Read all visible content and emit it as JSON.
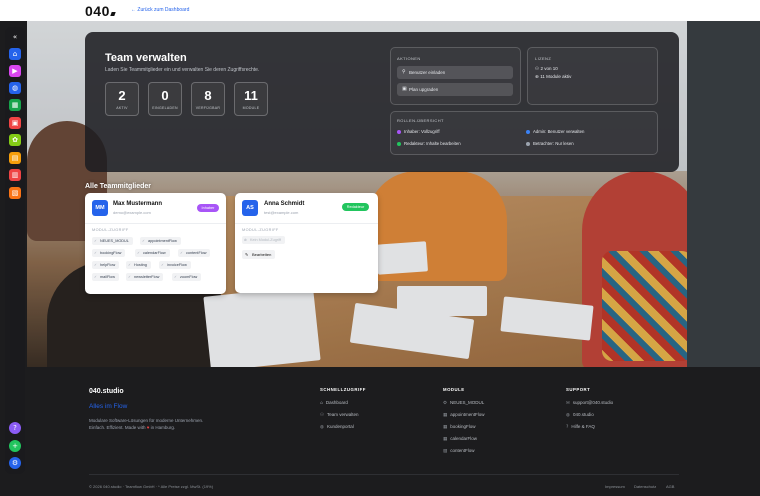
{
  "header": {
    "logo": "040",
    "back_link": "← Zurück zum Dashboard"
  },
  "sidebar": {
    "items": [
      {
        "icon": "collapse-icon",
        "color": "#2b2b30",
        "glyph": "«"
      },
      {
        "icon": "home-icon",
        "color": "#2563eb",
        "glyph": "⌂"
      },
      {
        "icon": "video-icon",
        "color": "#d946ef",
        "glyph": "▶"
      },
      {
        "icon": "globe-icon",
        "color": "#2563eb",
        "glyph": "◍"
      },
      {
        "icon": "calendar-icon",
        "color": "#16a34a",
        "glyph": "▦"
      },
      {
        "icon": "briefcase-icon",
        "color": "#ef4444",
        "glyph": "▣"
      },
      {
        "icon": "leaf-icon",
        "color": "#84cc16",
        "glyph": "✿"
      },
      {
        "icon": "calendar-check-icon",
        "color": "#f59e0b",
        "glyph": "▤"
      },
      {
        "icon": "invoice-icon",
        "color": "#ef4444",
        "glyph": "▥"
      },
      {
        "icon": "document-icon",
        "color": "#f97316",
        "glyph": "▧"
      },
      {
        "icon": "help-icon",
        "color": "#8b5cf6",
        "glyph": "?"
      },
      {
        "icon": "add-icon",
        "color": "#22c55e",
        "glyph": "+"
      },
      {
        "icon": "settings-icon",
        "color": "#2563eb",
        "glyph": "⚙"
      }
    ]
  },
  "team": {
    "title": "Team verwalten",
    "subtitle": "Laden Sie Teammitglieder ein und verwalten Sie deren Zugriffsrechte.",
    "stats": [
      {
        "value": "2",
        "label": "AKTIV"
      },
      {
        "value": "0",
        "label": "EINGELADEN"
      },
      {
        "value": "8",
        "label": "VERFÜGBAR"
      },
      {
        "value": "11",
        "label": "MODULE"
      }
    ]
  },
  "actions": {
    "title": "AKTIONEN",
    "invite": "Benutzer einladen",
    "upgrade": "Plan upgraden"
  },
  "license": {
    "title": "LIZENZ",
    "users": "2 von 10",
    "modules": "11 Module aktiv"
  },
  "roles": {
    "title": "ROLLEN-ÜBERSICHT",
    "items": [
      {
        "text": "Inhaber: Vollzugriff",
        "color": "#a855f7"
      },
      {
        "text": "Admin: Benutzer verwalten",
        "color": "#3b82f6"
      },
      {
        "text": "Redakteur: Inhalte bearbeiten",
        "color": "#22c55e"
      },
      {
        "text": "Betrachter: Nur lesen",
        "color": "#9ca3af"
      }
    ]
  },
  "members": {
    "title": "Alle Teammitglieder",
    "list": [
      {
        "initials": "MM",
        "name": "Max Mustermann",
        "email": "demo@example.com",
        "role": "Inhaber",
        "role_color": "#a855f7",
        "section": "MODUL-ZUGRIFF",
        "modules": [
          "NEUES_MODUL",
          "appointmentFlow",
          "bookingFlow",
          "calendarFlow",
          "contentFlow",
          "helpFlow",
          "Hosting",
          "invoiceFlow",
          "mailFlow",
          "newsletterFlow",
          "zoomFlow"
        ]
      },
      {
        "initials": "AS",
        "name": "Anna Schmidt",
        "email": "test@example.com",
        "role": "Redakteur",
        "role_color": "#22c55e",
        "section": "MODUL-ZUGRIFF",
        "no_access": "Kein Modul-Zugriff",
        "edit": "Bearbeiten"
      }
    ]
  },
  "footer": {
    "brand": "040.studio",
    "tagline": "Alles im Flow",
    "desc_1": "Modulare Software-Lösungen für moderne Unternehmen.",
    "desc_2a": "Einfach. Effizient. Made with",
    "heart": "♥",
    "desc_2b": "in Hamburg.",
    "quick": {
      "title": "SCHNELLZUGRIFF",
      "links": [
        "Dashboard",
        "Team verwalten",
        "Kundenportal"
      ]
    },
    "modules": {
      "title": "MODULE",
      "links": [
        "NEUES_MODUL",
        "appointmentFlow",
        "bookingFlow",
        "calendarFlow",
        "contentFlow"
      ]
    },
    "support": {
      "title": "SUPPORT",
      "links": [
        "support@040.studio",
        "040.studio",
        "Hilfe & FAQ"
      ]
    },
    "copyright": "© 2026 040.studio · Teamflow GmbH · * Alle Preise zzgl. MwSt. (19%)",
    "legal": [
      "Impressum",
      "Datenschutz",
      "AGB"
    ]
  }
}
